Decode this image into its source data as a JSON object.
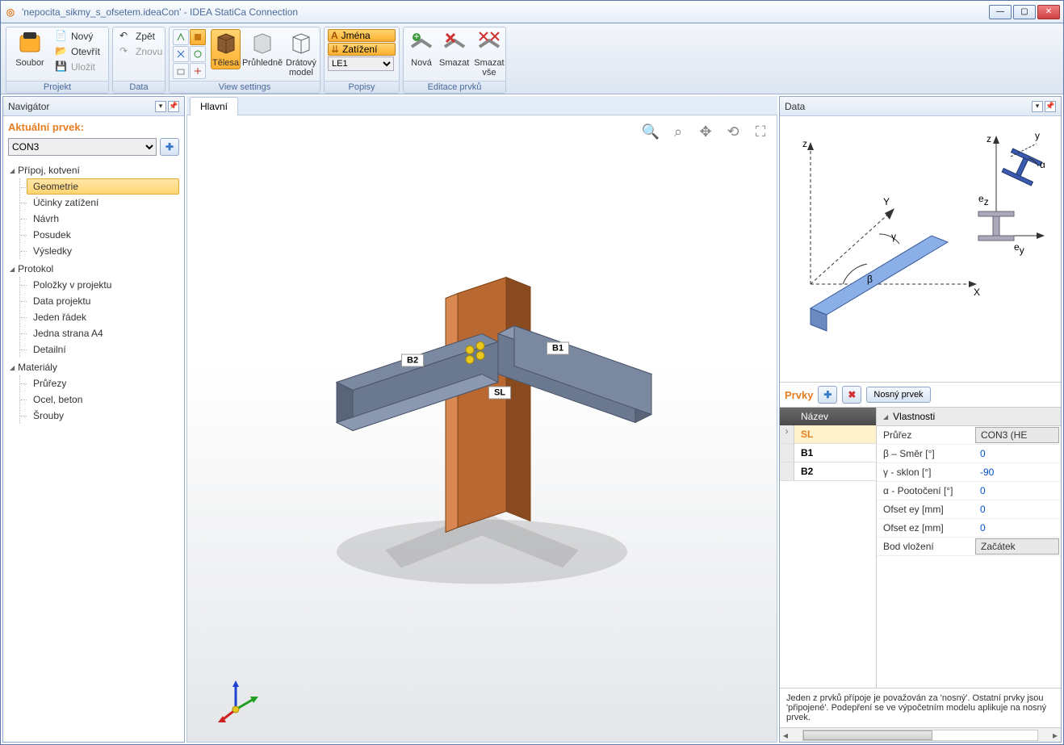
{
  "window": {
    "title": "'nepocita_sikmy_s_ofsetem.ideaCon' - IDEA StatiCa Connection"
  },
  "ribbon": {
    "soubor": "Soubor",
    "file": {
      "novy": "Nový",
      "otevrit": "Otevřít",
      "ulozit": "Uložit"
    },
    "projekt": "Projekt",
    "data": {
      "zpet": "Zpět",
      "znovu": "Znovu",
      "label": "Data"
    },
    "view": {
      "telesa": "Tělesa",
      "pruhledne": "Průhledně",
      "dratovy": "Drátový model",
      "label": "View settings"
    },
    "popisy": {
      "jmena": "Jména",
      "zatizeni": "Zatížení",
      "le": "LE1",
      "label": "Popisy"
    },
    "editace": {
      "nova": "Nová",
      "smazat": "Smazat",
      "smazatvse": "Smazat vše",
      "label": "Editace prvků"
    }
  },
  "panels": {
    "navigator": "Navigátor",
    "hlavni": "Hlavní",
    "data": "Data"
  },
  "nav": {
    "title": "Aktuální prvek:",
    "combo": "CON3",
    "g1": "Přípoj, kotvení",
    "g1items": {
      "geometrie": "Geometrie",
      "ucinky": "Účinky zatížení",
      "navrh": "Návrh",
      "posudek": "Posudek",
      "vysledky": "Výsledky"
    },
    "g2": "Protokol",
    "g2items": {
      "polozky": "Položky v projektu",
      "dataproj": "Data projektu",
      "jedenradek": "Jeden řádek",
      "jednastrana": "Jedna strana A4",
      "detailni": "Detailní"
    },
    "g3": "Materiály",
    "g3items": {
      "prurezy": "Průřezy",
      "ocelbeton": "Ocel, beton",
      "srouby": "Šrouby"
    }
  },
  "viewport": {
    "b1": "B1",
    "b2": "B2",
    "sl": "SL"
  },
  "diagram": {
    "z": "z",
    "y": "y",
    "Y": "Y",
    "X": "X",
    "alpha": "α",
    "beta": "β",
    "gamma": "γ",
    "ez": "e",
    "ezsub": "z",
    "ey": "e",
    "eysub": "y"
  },
  "prvky": {
    "title": "Prvky",
    "nosny": "Nosný prvek",
    "nazev": "Název",
    "rows": {
      "sl": "SL",
      "b1": "B1",
      "b2": "B2"
    }
  },
  "props": {
    "title": "Vlastnosti",
    "prurez": "Průřez",
    "prurez_v": "CON3 (HE",
    "beta": "β – Směr [°]",
    "beta_v": "0",
    "gamma": "γ - sklon [°]",
    "gamma_v": "-90",
    "alpha": "α - Pootočení [°]",
    "alpha_v": "0",
    "ofsey": "Ofset ey [mm]",
    "ofsey_v": "0",
    "ofsez": "Ofset ez [mm]",
    "ofsez_v": "0",
    "bod": "Bod vložení",
    "bod_v": "Začátek"
  },
  "help": "Jeden z prvků přípoje je považován za 'nosný'. Ostatní prvky jsou 'připojené'. Podepření se ve výpočetním modelu aplikuje na nosný prvek."
}
